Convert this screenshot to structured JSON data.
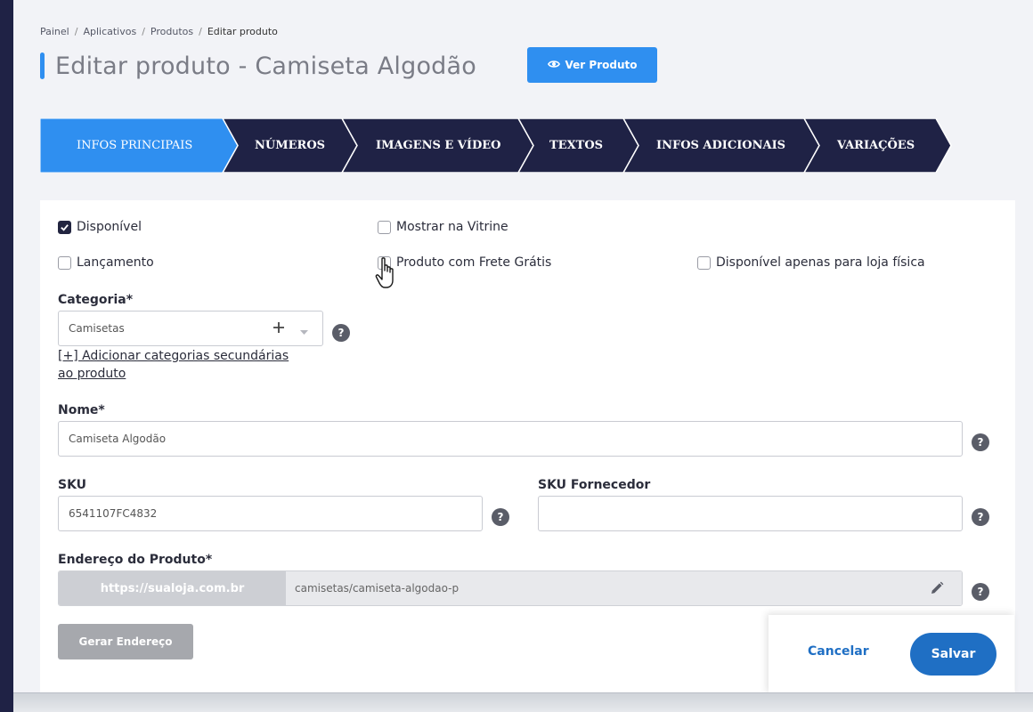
{
  "breadcrumb": [
    "Painel",
    "Aplicativos",
    "Produtos",
    "Editar produto"
  ],
  "page_title": "Editar produto - Camiseta Algodão",
  "view_button": "Ver Produto",
  "steps": [
    {
      "label": "INFOS PRINCIPAIS",
      "active": true
    },
    {
      "label": "NÚMEROS",
      "active": false
    },
    {
      "label": "IMAGENS E VÍDEO",
      "active": false
    },
    {
      "label": "TEXTOS",
      "active": false
    },
    {
      "label": "INFOS ADICIONAIS",
      "active": false
    },
    {
      "label": "VARIAÇÕES",
      "active": false
    }
  ],
  "checkboxes": {
    "disponivel": {
      "label": "Disponível",
      "checked": true
    },
    "vitrine": {
      "label": "Mostrar na Vitrine",
      "checked": false
    },
    "lancamento": {
      "label": "Lançamento",
      "checked": false
    },
    "frete": {
      "label": "Produto com Frete Grátis",
      "checked": false
    },
    "loja_fisica": {
      "label": "Disponível apenas para loja física",
      "checked": false
    }
  },
  "categoria": {
    "label": "Categoria*",
    "value": "Camisetas",
    "add_secondary_line1": "[+] Adicionar categorias secundárias",
    "add_secondary_line2": "ao produto"
  },
  "nome": {
    "label": "Nome*",
    "value": "Camiseta Algodão"
  },
  "sku": {
    "label": "SKU",
    "value": "6541107FC4832"
  },
  "sku_fornecedor": {
    "label": "SKU Fornecedor",
    "value": ""
  },
  "endereco": {
    "label": "Endereço do Produto*",
    "prefix": "https://sualoja.com.br",
    "slug": "camisetas/camiseta-algodao-p"
  },
  "gerar_button": "Gerar Endereço",
  "help_glyph": "?",
  "actions": {
    "cancel": "Cancelar",
    "save": "Salvar"
  },
  "colors": {
    "accent": "#2f8ff0",
    "nav_dark": "#1f2245",
    "primary_button": "#1f6fc4"
  }
}
